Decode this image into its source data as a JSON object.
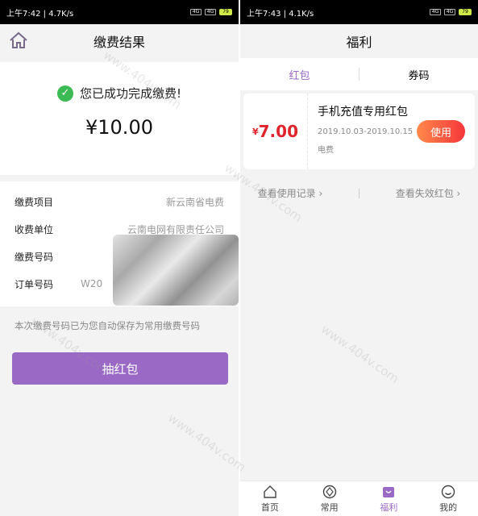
{
  "left": {
    "status": {
      "time": "上午7:42",
      "speed": "4.7K/s",
      "battery": "79"
    },
    "title": "缴费结果",
    "success_text": "您已成功完成缴费!",
    "amount": "¥10.00",
    "rows": [
      {
        "key": "缴费项目",
        "value": "新云南省电费"
      },
      {
        "key": "收费单位",
        "value": "云南电网有限责任公司"
      },
      {
        "key": "缴费号码",
        "value": ""
      },
      {
        "key": "订单号码",
        "value": "W20"
      }
    ],
    "note": "本次缴费号码已为您自动保存为常用缴费号码",
    "draw_button": "抽红包"
  },
  "right": {
    "status": {
      "time": "上午7:43",
      "speed": "4.1K/s",
      "battery": "79"
    },
    "title": "福利",
    "tabs": [
      {
        "label": "红包"
      },
      {
        "label": "券码"
      }
    ],
    "coupon": {
      "currency": "¥",
      "value": "7.00",
      "title": "手机充值专用红包",
      "date": "2019.10.03-2019.10.15",
      "type": "电费",
      "use_button": "使用"
    },
    "links": [
      {
        "label": "查看使用记录",
        "chevron": "›"
      },
      {
        "label": "查看失效红包",
        "chevron": "›"
      }
    ],
    "tabbar": [
      {
        "label": "首页",
        "icon": "home-icon"
      },
      {
        "label": "常用",
        "icon": "common-icon"
      },
      {
        "label": "福利",
        "icon": "welfare-icon"
      },
      {
        "label": "我的",
        "icon": "mine-icon"
      }
    ]
  },
  "watermark": "www.404v.com",
  "colors": {
    "accent": "#9a69c5",
    "price_red": "#e0242d",
    "success_green": "#3cba54"
  }
}
